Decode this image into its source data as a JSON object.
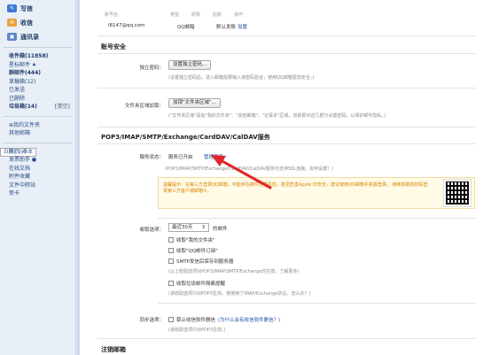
{
  "sidebar": {
    "compose": "写信",
    "inbox_btn": "收信",
    "contacts": "通讯录",
    "folders": [
      {
        "label": "收件箱(11858)",
        "bold": true
      },
      {
        "label": "星标邮件 ★"
      },
      {
        "label": "群邮件(444)",
        "bold": true
      },
      {
        "label": "草稿箱(12)"
      },
      {
        "label": "已发送"
      },
      {
        "label": "已删除"
      },
      {
        "label": "垃圾箱(14)",
        "bold": true,
        "extra": "[清空]"
      }
    ],
    "folders2": [
      {
        "label": "⊕我的文件夹"
      },
      {
        "label": "其他邮箱"
      }
    ],
    "apps": [
      {
        "label": "日历 | 记事本",
        "sel": true
      },
      {
        "label": "简历 ✓"
      },
      {
        "label": "发票助手 ●"
      },
      {
        "label": "在线文档"
      },
      {
        "label": "附件收藏"
      },
      {
        "label": "文件中转站"
      },
      {
        "label": "贺卡"
      }
    ]
  },
  "accounts": {
    "headers": [
      "账号名",
      "类型",
      "昵称",
      "此账",
      "操作"
    ],
    "row": [
      "l8147@qq.com",
      "QQ邮箱",
      "默认发账",
      "设置"
    ]
  },
  "security": {
    "title": "账号安全",
    "pwd_label": "独立密码：",
    "pwd_btn": "设置独立密码...",
    "pwd_note": "(设置独立密码后，进入邮箱需要输入该密码验证，使用QQ邮箱更加安全。)",
    "folder_label": "文件夹区域加锁：",
    "folder_btn": "加锁\"文件夹区域\"...",
    "folder_note": "(\"文件夹区域\"是指\"我的文件夹\"、\"其他邮箱\"、\"记事本\"区域，加锁即对这几部分设置密码，以保护邮件隐私。)"
  },
  "pop": {
    "title": "POP3/IMAP/SMTP/Exchange/CardDAV/CalDAV服务",
    "status_label": "服务状态：",
    "status_val": "服务已开启",
    "manage": "管理服务",
    "status_note": "(POP3/IMAP/SMTP/Exchange/CardDAV/CalDAV服务均支持SSL连接。如何设置？)",
    "warn": "温馨提示：在第三方登录QQ邮箱，可能存在邮件泄露风险，甚至危害Apple ID安全，建议使用QQ邮箱手机版登录。 继续获取授权码登录第三方客户端邮箱⑦。",
    "recv_label": "收取选项：",
    "recv_select": "最近30天",
    "recv_suffix": "的邮件",
    "opts": [
      "收取\"我的文件夹\"",
      "收取\"QQ邮件订阅\"",
      "SMTP发信后保存到服务器"
    ],
    "opts_note": "(以上收取选项对POP3/IMAP/SMTP/Exchange均生效。了解更多)",
    "junk": "收取垃圾邮件隔离提醒",
    "junk_note": "(该收取选项只对POP3生效。我使用了IMAP/Exchange协议，怎么办？)",
    "sync_label": "同步选项：",
    "sync_opt": "禁止收信软件删信",
    "sync_hint": "(为什么会有收信软件删信？)",
    "sync_note": "(该收取选项只对POP3生效。)"
  },
  "logout": {
    "title": "注销邮箱"
  },
  "colors": {
    "accent": "#1d52a8",
    "arrow": "#e0262b"
  }
}
